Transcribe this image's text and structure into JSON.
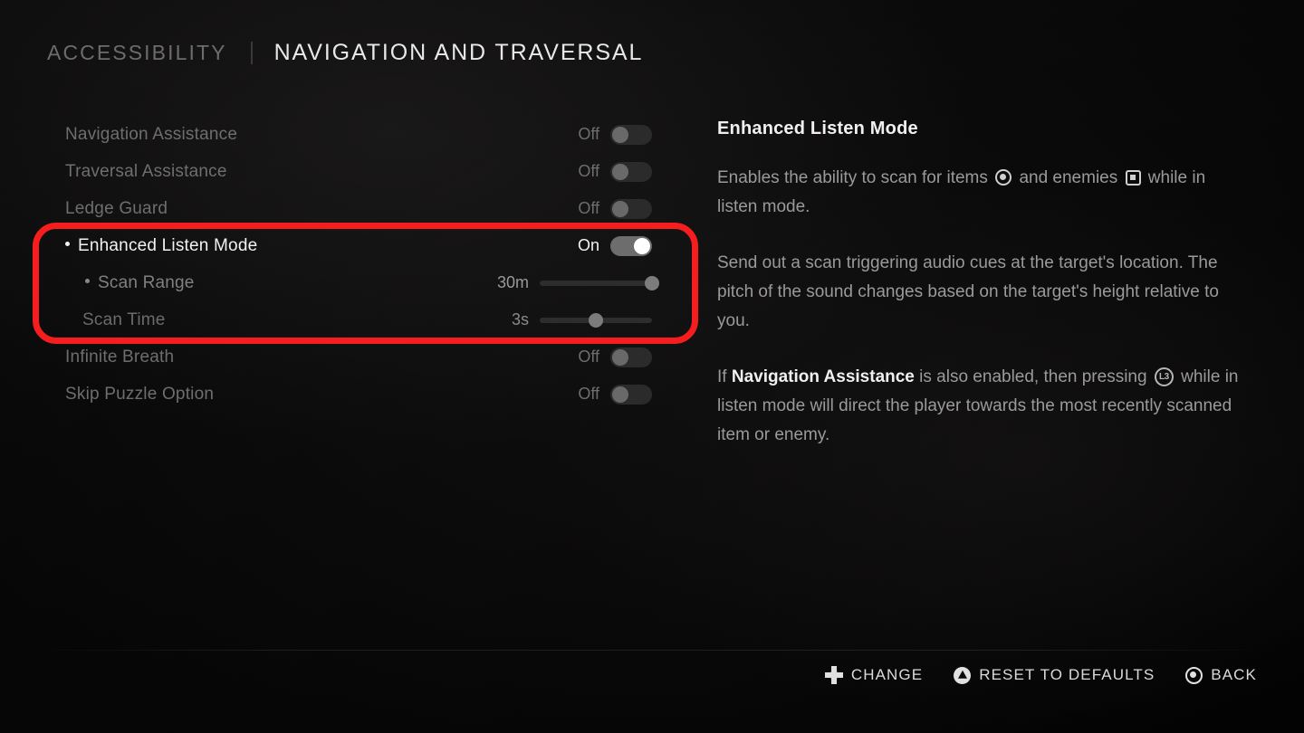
{
  "header": {
    "breadcrumb_parent": "ACCESSIBILITY",
    "breadcrumb_current": "NAVIGATION AND TRAVERSAL"
  },
  "settings": {
    "rows": [
      {
        "label": "Navigation Assistance",
        "value": "Off",
        "control": "toggle",
        "state": "off"
      },
      {
        "label": "Traversal Assistance",
        "value": "Off",
        "control": "toggle",
        "state": "off"
      },
      {
        "label": "Ledge Guard",
        "value": "Off",
        "control": "toggle",
        "state": "off"
      },
      {
        "label": "Enhanced Listen Mode",
        "value": "On",
        "control": "toggle",
        "state": "on"
      },
      {
        "label": "Scan Range",
        "value": "30m",
        "control": "slider",
        "percent": 100
      },
      {
        "label": "Scan Time",
        "value": "3s",
        "control": "slider",
        "percent": 50
      },
      {
        "label": "Infinite Breath",
        "value": "Off",
        "control": "toggle",
        "state": "off"
      },
      {
        "label": "Skip Puzzle Option",
        "value": "Off",
        "control": "toggle",
        "state": "off"
      }
    ]
  },
  "description": {
    "title": "Enhanced Listen Mode",
    "p1_a": "Enables the ability to scan for items",
    "p1_b": "and enemies",
    "p1_c": "while in listen mode.",
    "p2": "Send out a scan triggering audio cues at the target's location. The pitch of the sound changes based on the target's height relative to you.",
    "p3_a": "If",
    "p3_bold": "Navigation Assistance",
    "p3_b": "is also enabled, then pressing",
    "p3_c": "while in listen mode will direct the player towards the most recently scanned item or enemy.",
    "l3_button_label": "L3"
  },
  "actions": [
    {
      "label": "CHANGE",
      "icon": "dpad-icon"
    },
    {
      "label": "RESET TO DEFAULTS",
      "icon": "triangle-button-icon"
    },
    {
      "label": "BACK",
      "icon": "circle-button-icon"
    }
  ],
  "colors": {
    "highlight_red": "#f51d1d",
    "accent_white": "#ffffff",
    "text_dim": "#6f6e6e"
  }
}
